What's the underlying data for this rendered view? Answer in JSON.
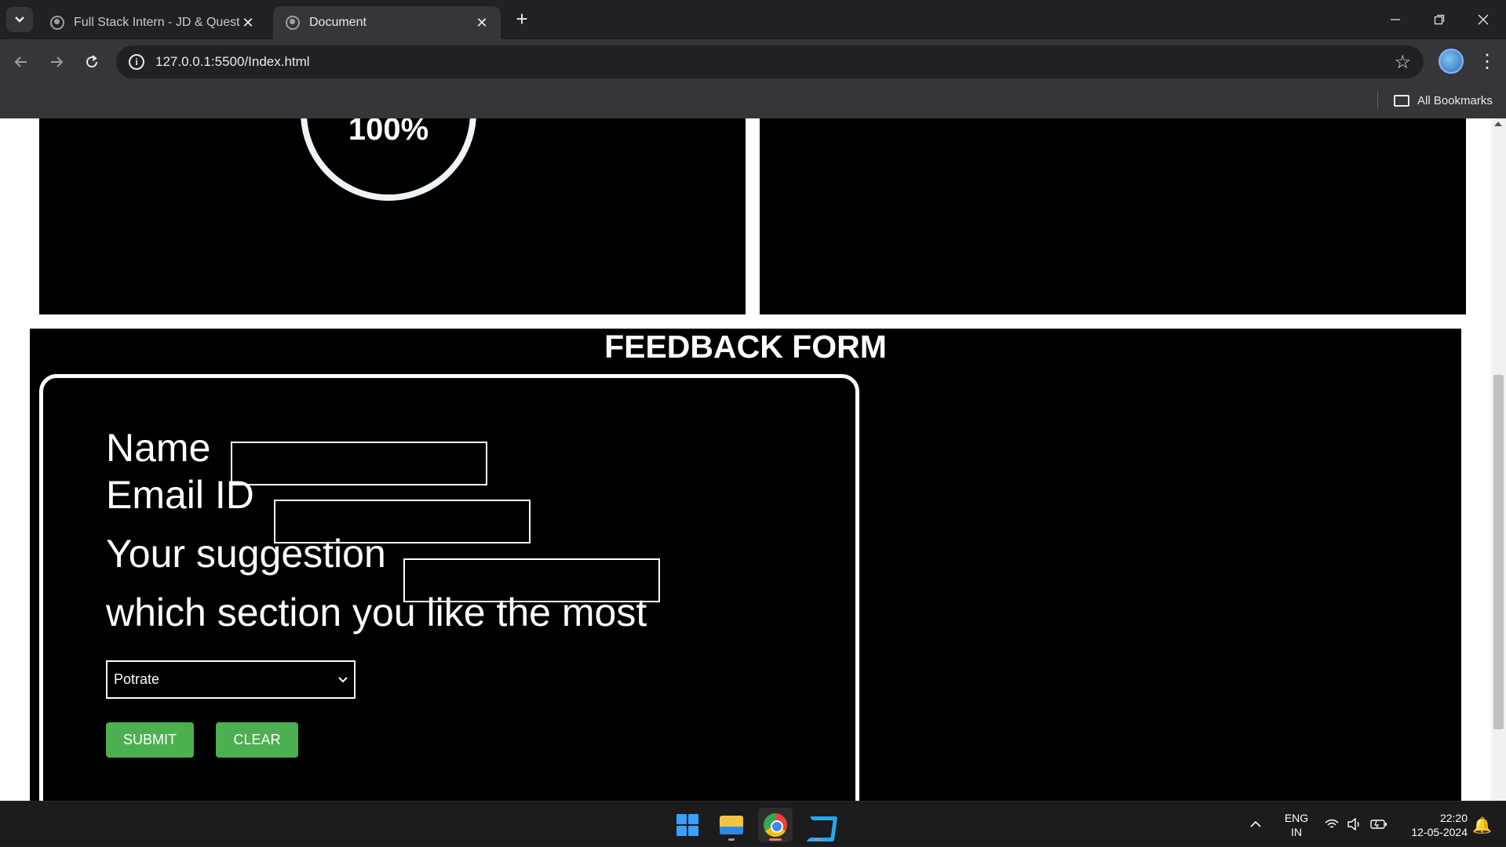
{
  "browser": {
    "tabs": [
      {
        "title": "Full Stack Intern - JD & Questio",
        "active": false
      },
      {
        "title": "Document",
        "active": true
      }
    ],
    "tab_close_glyph": "✕",
    "new_tab_glyph": "+",
    "url": "127.0.0.1:5500/Index.html",
    "bookmarks_label": "All Bookmarks"
  },
  "page": {
    "progress_text": "100%",
    "progress_value": 1.0,
    "feedback_title": "FEEDBACK FORM",
    "form": {
      "name_label": "Name",
      "name_value": "",
      "email_label": "Email ID",
      "email_value": "",
      "suggestion_label": "Your suggestion",
      "suggestion_value": "",
      "section_question": "which section you like the most",
      "section_selected": "Potrate",
      "submit_label": "SUBMIT",
      "clear_label": "CLEAR"
    },
    "colors": {
      "panel_bg": "#000000",
      "button_green": "#4caf50",
      "page_bg": "#ffffff"
    }
  },
  "taskbar": {
    "apps": [
      "windows-start",
      "file-explorer",
      "google-chrome",
      "visual-studio-code"
    ],
    "language_line1": "ENG",
    "language_line2": "IN",
    "time": "22:20",
    "date": "12-05-2024"
  }
}
